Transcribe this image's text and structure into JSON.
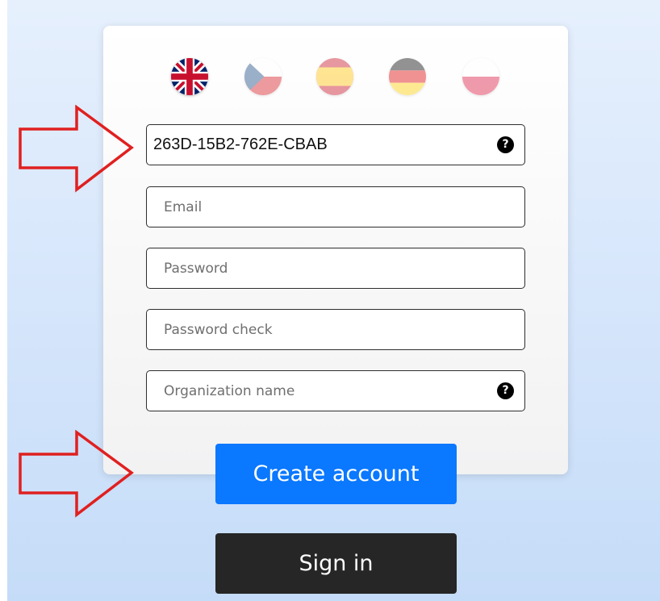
{
  "languages": [
    {
      "code": "en",
      "icon": "uk-flag-icon",
      "active": true
    },
    {
      "code": "cs",
      "icon": "czech-flag-icon",
      "active": false
    },
    {
      "code": "es",
      "icon": "spanish-flag-icon",
      "active": false
    },
    {
      "code": "de",
      "icon": "german-flag-icon",
      "active": false
    },
    {
      "code": "pl",
      "icon": "polish-flag-icon",
      "active": false
    }
  ],
  "form": {
    "license_key": {
      "value": "263D-15B2-762E-CBAB",
      "help_icon": "question-icon"
    },
    "email": {
      "placeholder": "Email",
      "value": ""
    },
    "password": {
      "placeholder": "Password",
      "value": ""
    },
    "password_check": {
      "placeholder": "Password check",
      "value": ""
    },
    "organization": {
      "placeholder": "Organization name",
      "value": "",
      "help_icon": "question-icon"
    }
  },
  "buttons": {
    "create_account": "Create account",
    "sign_in": "Sign in"
  },
  "help_glyph": "?",
  "colors": {
    "primary_button": "#0a78ff",
    "dark_button": "#262626",
    "annotation_arrow": "#e02020"
  }
}
